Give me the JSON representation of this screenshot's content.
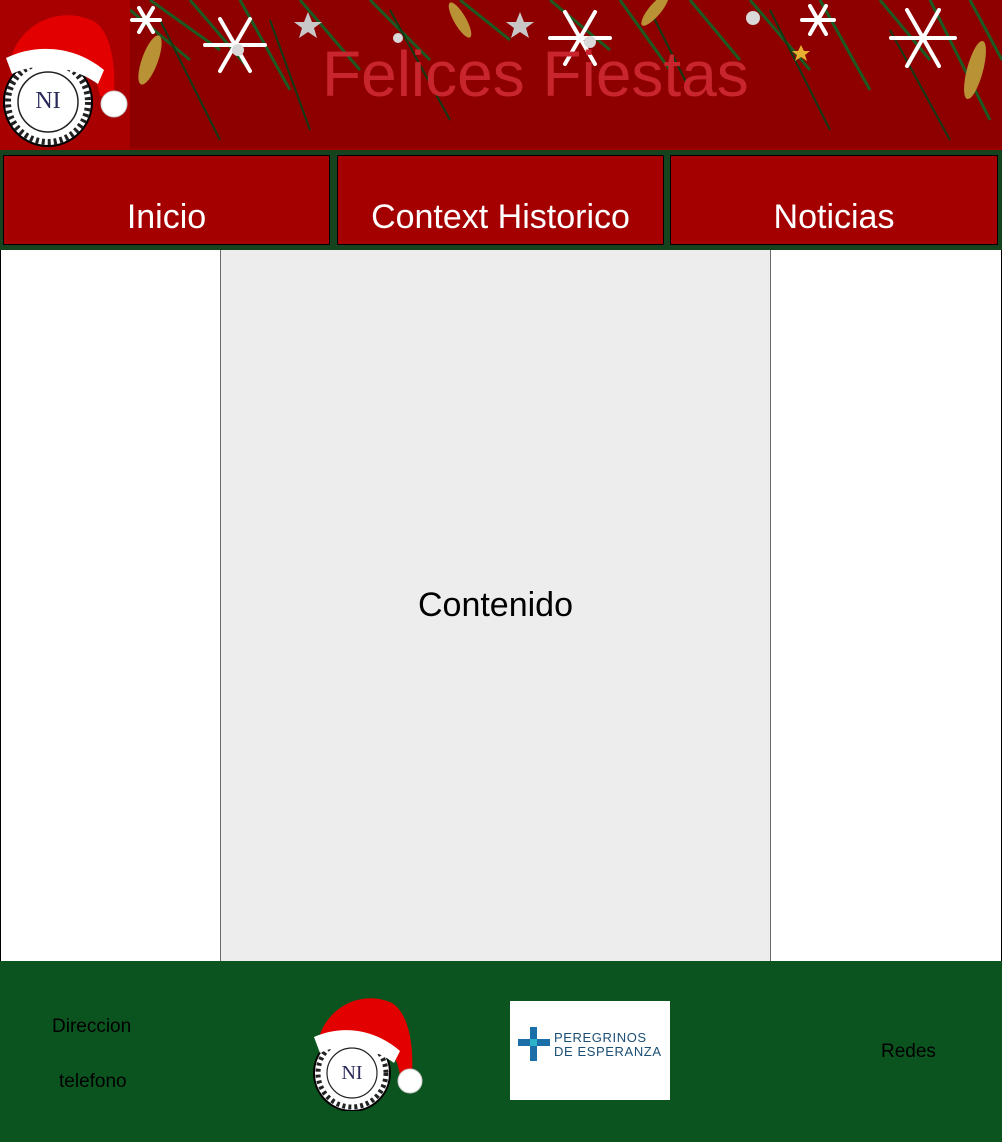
{
  "header": {
    "title": "Felices Fiestas",
    "logo_icon": "school-crest-santa-hat",
    "banner": "christmas-garland-decoration"
  },
  "nav": {
    "items": [
      {
        "label": "Inicio"
      },
      {
        "label": "Context Historico"
      },
      {
        "label": "Noticias"
      }
    ]
  },
  "main": {
    "content_label": "Contenido"
  },
  "footer": {
    "address_label": "Direccion",
    "phone_label": "telefono",
    "social_label": "Redes",
    "partner": {
      "line1": "PEREGRINOS",
      "line2": "DE ESPERANZA"
    }
  },
  "colors": {
    "header_red": "#a00000",
    "nav_bg": "#14431d",
    "nav_item": "#a50000",
    "title_red": "#c9252e",
    "content_bg": "#ededed",
    "footer_green": "#0c541f"
  }
}
